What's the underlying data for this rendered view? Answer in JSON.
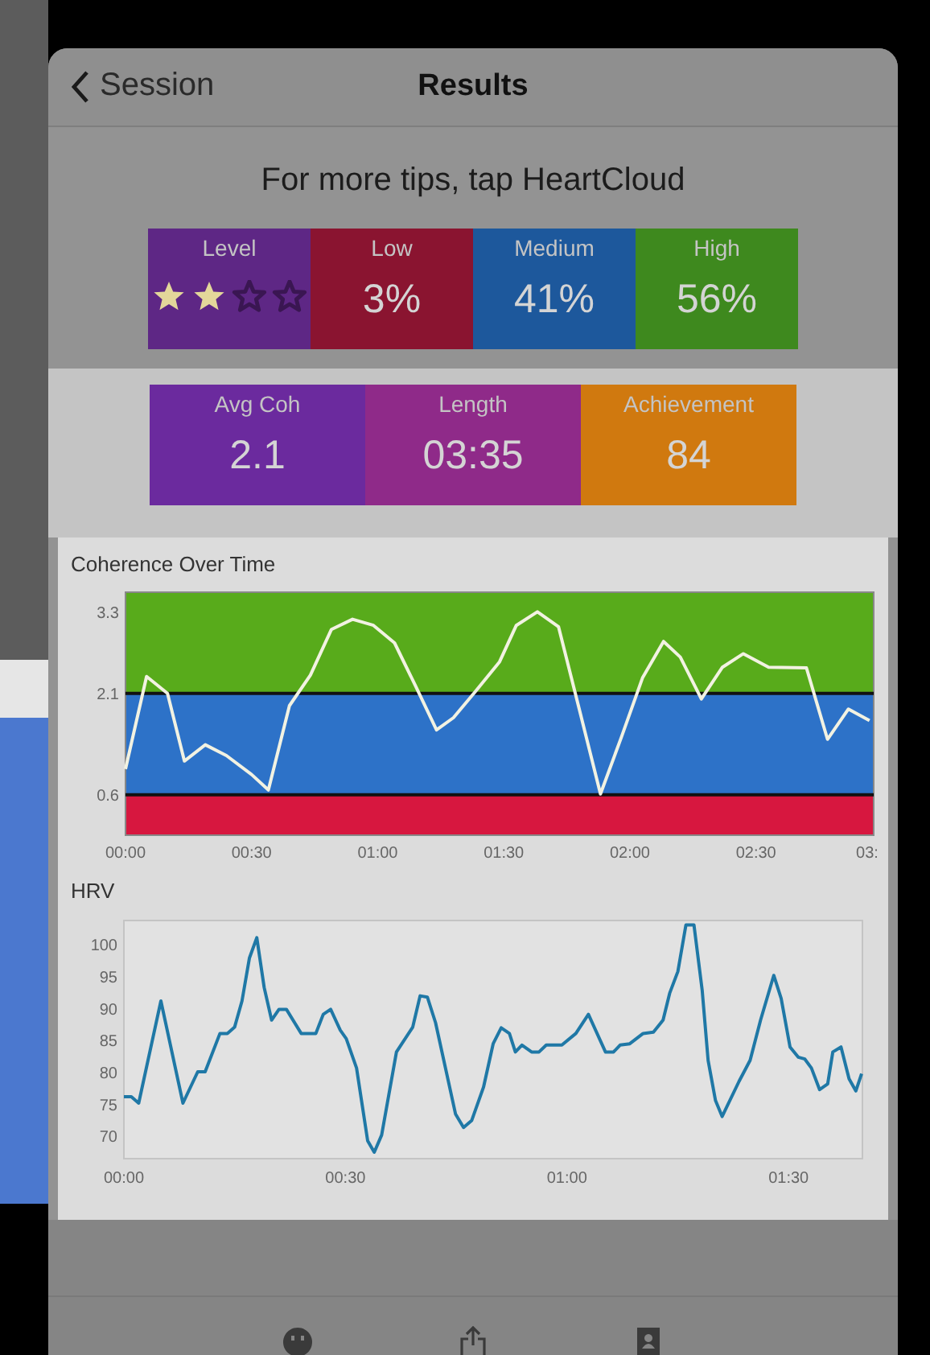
{
  "nav": {
    "back_label": "Session",
    "title": "Results"
  },
  "tip": "For more tips, tap HeartCloud",
  "cards": [
    {
      "kind": "stars",
      "label": "Level",
      "stars": 2,
      "color": "#5e2785"
    },
    {
      "kind": "value",
      "label": "Low",
      "value": "3%",
      "color": "#8a1430"
    },
    {
      "kind": "value",
      "label": "Medium",
      "value": "41%",
      "color": "#1d589c"
    },
    {
      "kind": "value",
      "label": "High",
      "value": "56%",
      "color": "#3e891e"
    }
  ],
  "summary": [
    {
      "label": "Avg Coh",
      "value": "2.1",
      "color": "#6b2a9e"
    },
    {
      "label": "Length",
      "value": "03:35",
      "color": "#8f2a89"
    },
    {
      "label": "Achievement",
      "value": "84",
      "color": "#d0790f"
    }
  ],
  "coherence": {
    "chart_data": {
      "type": "line",
      "title": "Coherence Over Time",
      "x": [
        0,
        5,
        10,
        14,
        19,
        24,
        30,
        34,
        39,
        44,
        49,
        54,
        59,
        64,
        69,
        74,
        78,
        83,
        89,
        93,
        98,
        103,
        108,
        113,
        118,
        123,
        128,
        132,
        137,
        142,
        147,
        153,
        162,
        167,
        172,
        177
      ],
      "series": [
        {
          "color": "#f2f2e2",
          "values": [
            0.98,
            2.35,
            2.1,
            1.1,
            1.34,
            1.18,
            0.9,
            0.67,
            1.92,
            2.37,
            3.05,
            3.2,
            3.11,
            2.85,
            2.21,
            1.56,
            1.74,
            2.11,
            2.57,
            3.11,
            3.31,
            3.09,
            1.86,
            0.61,
            1.46,
            2.33,
            2.87,
            2.64,
            2.02,
            2.49,
            2.69,
            2.49,
            2.48,
            1.42,
            1.87,
            1.7
          ]
        }
      ],
      "xlim": [
        0,
        178
      ],
      "ylim": [
        0,
        3.6
      ],
      "xticks": [
        {
          "value": 0,
          "label": "00:00"
        },
        {
          "value": 30,
          "label": "00:30"
        },
        {
          "value": 60,
          "label": "01:00"
        },
        {
          "value": 90,
          "label": "01:30"
        },
        {
          "value": 120,
          "label": "02:00"
        },
        {
          "value": 150,
          "label": "02:30"
        }
      ],
      "yticks": [
        0.6,
        2.1,
        3.3
      ],
      "bands": [
        {
          "axis": "y",
          "from": 2.1,
          "to": 3.6,
          "color": "#58ab1b"
        },
        {
          "axis": "y",
          "from": 0.6,
          "to": 2.1,
          "color": "#2d72c8"
        },
        {
          "axis": "y",
          "from": 0,
          "to": 0.6,
          "color": "#d7173f"
        }
      ]
    },
    "cut_tick_label": "03:"
  },
  "hrv": {
    "chart_data": {
      "type": "line",
      "title": "HRV",
      "x": [
        0,
        1,
        2,
        5,
        8,
        10,
        11,
        13,
        14,
        15,
        16,
        17,
        18,
        19,
        20,
        21,
        22,
        24,
        26,
        27,
        28,
        29.3,
        30.1,
        31.5,
        33,
        33.9,
        34.9,
        36.9,
        39.1,
        40.1,
        41.1,
        42.2,
        44.9,
        46,
        47.1,
        48.7,
        50,
        51.1,
        52.2,
        53,
        53.9,
        55.2,
        56.2,
        57.2,
        59.3,
        61.2,
        62.9,
        65.2,
        66.3,
        67.2,
        68.5,
        70.3,
        71.7,
        73,
        73.9,
        75,
        76.1,
        77.2,
        78.3,
        79.1,
        80.1,
        81,
        83.3,
        84.8,
        86.2,
        88,
        89,
        90.2,
        91.3,
        92.2,
        93.1,
        94.2,
        95.3,
        96,
        97.1,
        98.2,
        99.1,
        99.9
      ],
      "series": [
        {
          "color": "#1f78a6",
          "values": [
            76.2,
            76.2,
            75.2,
            91.2,
            75.2,
            80.1,
            80.1,
            86.1,
            86.1,
            87.1,
            91.2,
            97.9,
            101.1,
            93.3,
            88.2,
            89.9,
            89.9,
            86.1,
            86.1,
            89.1,
            89.9,
            86.6,
            85.3,
            80.7,
            69.3,
            67.5,
            70.2,
            83.2,
            87.1,
            92,
            91.8,
            87.8,
            73.5,
            71.4,
            72.5,
            77.7,
            84.5,
            87,
            86.1,
            83.2,
            84.3,
            83.2,
            83.2,
            84.3,
            84.3,
            86.1,
            89.1,
            83.2,
            83.2,
            84.3,
            84.5,
            86.1,
            86.3,
            88.2,
            92.4,
            95.8,
            103.1,
            103.1,
            92.9,
            81.9,
            75.6,
            73.1,
            78.6,
            81.9,
            88.2,
            95.2,
            91.6,
            84,
            82.4,
            82.1,
            80.7,
            77.3,
            78.2,
            83.2,
            84,
            79,
            77.1,
            79.8
          ]
        }
      ],
      "xlim": [
        0,
        100
      ],
      "ylim": [
        66.5,
        103.8
      ],
      "xticks": [
        {
          "value": 0,
          "label": "00:00"
        },
        {
          "value": 30,
          "label": "00:30"
        },
        {
          "value": 60,
          "label": "01:00"
        },
        {
          "value": 90,
          "label": "01:30"
        }
      ],
      "yticks": [
        70,
        75,
        80,
        85,
        90,
        95,
        100
      ]
    }
  }
}
